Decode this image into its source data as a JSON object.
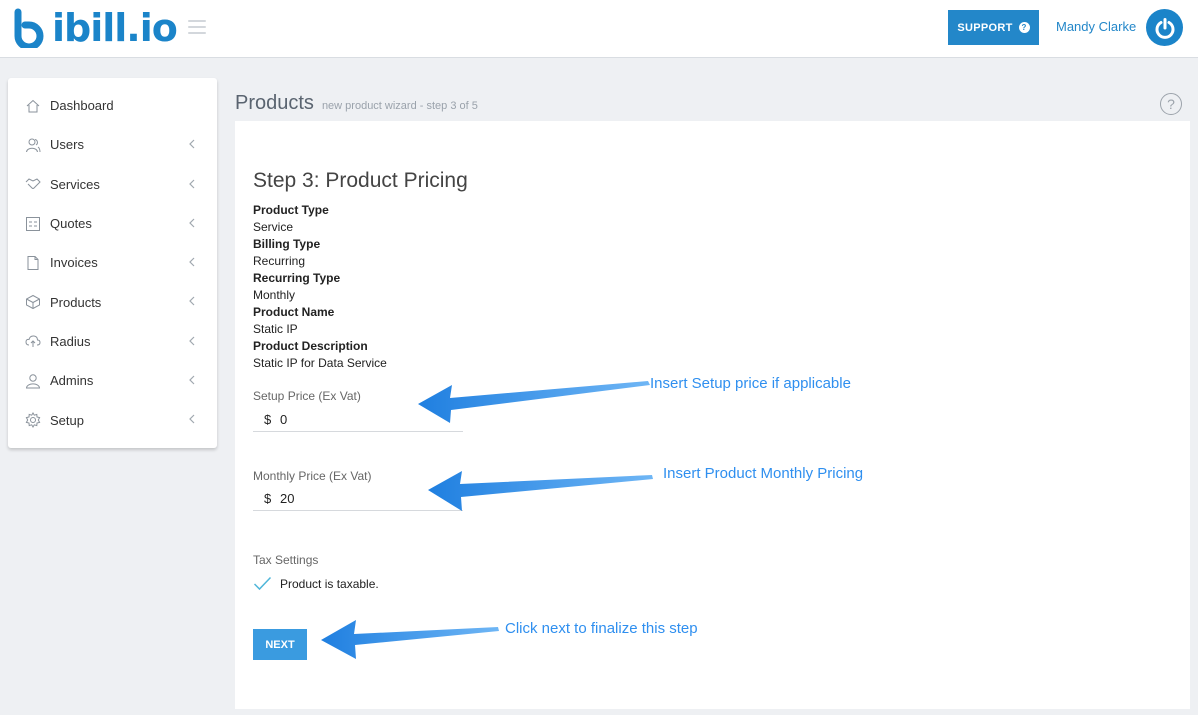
{
  "header": {
    "logo_text": "ibill.io",
    "support_label": "SUPPORT",
    "support_icon": "question-circle-icon",
    "user_name": "Mandy Clarke",
    "avatar_icon": "power-icon",
    "brand_color": "#1b84c9"
  },
  "sidebar": {
    "items": [
      {
        "label": "Dashboard",
        "icon": "home-icon",
        "has_chevron": false
      },
      {
        "label": "Users",
        "icon": "users-icon",
        "has_chevron": true
      },
      {
        "label": "Services",
        "icon": "handshake-icon",
        "has_chevron": true
      },
      {
        "label": "Quotes",
        "icon": "calculator-icon",
        "has_chevron": true
      },
      {
        "label": "Invoices",
        "icon": "document-icon",
        "has_chevron": true
      },
      {
        "label": "Products",
        "icon": "box-icon",
        "has_chevron": true
      },
      {
        "label": "Radius",
        "icon": "cloud-upload-icon",
        "has_chevron": true
      },
      {
        "label": "Admins",
        "icon": "user-icon",
        "has_chevron": true
      },
      {
        "label": "Setup",
        "icon": "gear-icon",
        "has_chevron": true
      }
    ]
  },
  "page": {
    "title": "Products",
    "subtitle": "new product wizard - step 3 of 5",
    "help_icon": "help-icon"
  },
  "wizard": {
    "step_title": "Step 3: Product Pricing",
    "summary": [
      {
        "label": "Product Type",
        "value": "Service"
      },
      {
        "label": "Billing Type",
        "value": "Recurring"
      },
      {
        "label": "Recurring Type",
        "value": "Monthly"
      },
      {
        "label": "Product Name",
        "value": "Static IP"
      },
      {
        "label": "Product Description",
        "value": "Static IP for Data Service"
      }
    ],
    "setup_price": {
      "label": "Setup Price (Ex Vat)",
      "currency": "$",
      "value": "0"
    },
    "monthly_price": {
      "label": "Monthly Price (Ex Vat)",
      "currency": "$",
      "value": "20"
    },
    "tax_settings_label": "Tax Settings",
    "taxable_label": "Product is taxable.",
    "taxable_checked": true,
    "next_label": "NEXT"
  },
  "annotations": {
    "setup": "Insert Setup price if applicable",
    "monthly": "Insert Product Monthly Pricing",
    "next": "Click next to finalize this step",
    "color": "#2f8fef"
  }
}
